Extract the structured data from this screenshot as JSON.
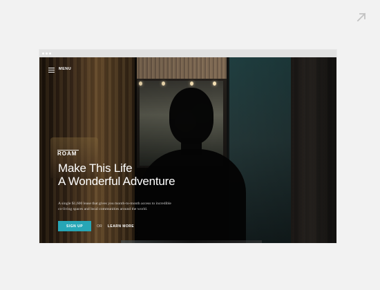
{
  "page": {
    "background": "#f2f2f2"
  },
  "corner_link": {
    "icon": "arrow-up-right-icon",
    "color": "#c2c2c2"
  },
  "browser": {
    "frame_color": "#e1e1e1",
    "dot_color": "#ffffff"
  },
  "nav": {
    "menu_icon": "hamburger-icon",
    "menu_label": "MENU"
  },
  "hero": {
    "brand": "ROAM",
    "headline_line_1": "Make This Life",
    "headline_line_2": "A Wonderful Adventure",
    "subcopy_line_1": "A single $1,600 lease that gives you month-to-month access to incredible",
    "subcopy_line_2": "co-living spaces and local communities around the world."
  },
  "actions": {
    "signup_label": "SIGN UP",
    "or_label": "OR",
    "learn_more_label": "LEARN MORE",
    "accent_color": "#27a6b6"
  }
}
